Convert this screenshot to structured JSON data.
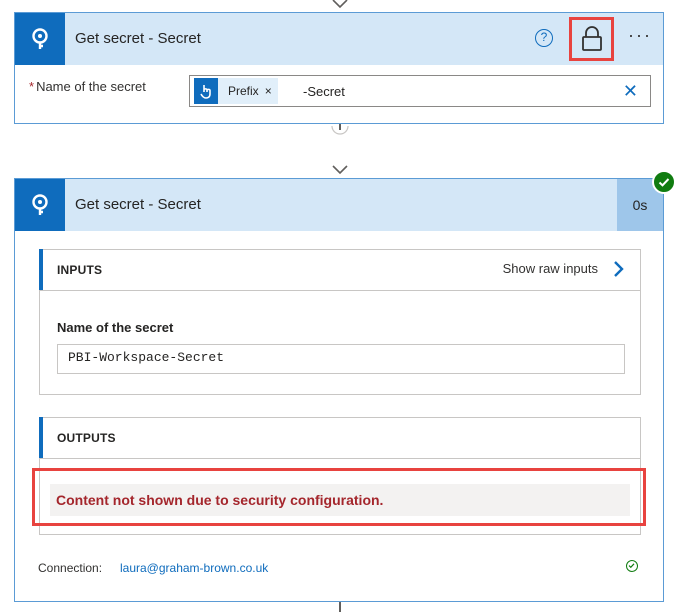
{
  "card1": {
    "title": "Get secret - Secret",
    "field_label": "Name of the secret",
    "required_marker": "*",
    "token_label": "Prefix",
    "token_remove": "×",
    "token_suffix": "-Secret",
    "clear_glyph": "✕",
    "help_glyph": "?",
    "more_glyph": "···"
  },
  "card2": {
    "title": "Get secret - Secret",
    "duration": "0s",
    "inputs": {
      "heading": "INPUTS",
      "raw_link": "Show raw inputs",
      "field_label": "Name of the secret",
      "field_value": "PBI-Workspace-Secret"
    },
    "outputs": {
      "heading": "OUTPUTS",
      "message": "Content not shown due to security configuration."
    },
    "connection_label": "Connection:",
    "connection_value": "laura@graham-brown.co.uk"
  },
  "colors": {
    "accent": "#0f6cbd",
    "header_bg": "#d4e7f7",
    "highlight": "#e8433f",
    "success": "#107c10",
    "error_text": "#a4262c"
  }
}
